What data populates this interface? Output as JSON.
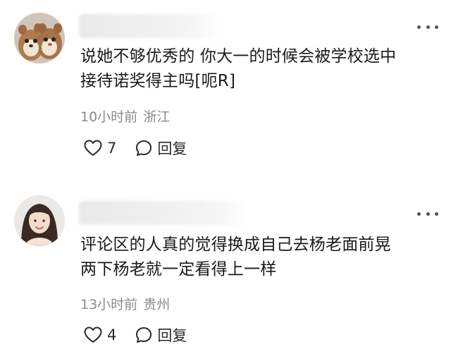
{
  "comments": [
    {
      "content": "说她不够优秀的 你大一的时候会被学校选中\n接待诺奖得主吗[呃R]",
      "time": "10小时前",
      "location": "浙江",
      "like_count": "7",
      "reply_label": "回复",
      "avatar_icon": "chipmunk-plush-avatar"
    },
    {
      "content": "评论区的人真的觉得换成自己去杨老面前晃\n两下杨老就一定看得上一样",
      "time": "13小时前",
      "location": "贵州",
      "like_count": "4",
      "reply_label": "回复",
      "avatar_icon": "woman-portrait-avatar"
    }
  ],
  "icons": {
    "like": "heart-outline-icon",
    "reply": "speech-bubble-icon",
    "more": "more-dots-icon"
  },
  "colors": {
    "text": "#1a1a1a",
    "meta": "#8a8a8a",
    "icon": "#2a2a2a"
  }
}
